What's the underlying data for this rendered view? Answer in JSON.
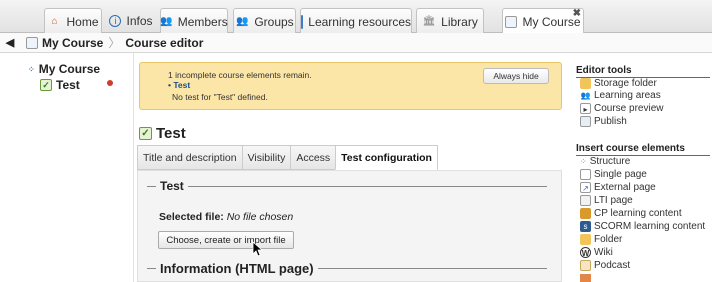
{
  "tabs": [
    {
      "label": "Home",
      "icon": "home-icon"
    },
    {
      "label": "Infos",
      "icon": "info-icon"
    },
    {
      "label": "Members",
      "icon": "members-icon"
    },
    {
      "label": "Groups",
      "icon": "groups-icon"
    },
    {
      "label": "Learning resources",
      "icon": "learning-resources-icon"
    },
    {
      "label": "Library",
      "icon": "library-icon"
    },
    {
      "label": "My Course",
      "icon": "course-icon",
      "active": true
    }
  ],
  "breadcrumb": {
    "course": "My Course",
    "current": "Course editor"
  },
  "tree": {
    "root": "My Course",
    "child": "Test"
  },
  "warning": {
    "line1": "1 incomplete course elements remain.",
    "item": "Test",
    "detail": "No test for \"Test\" defined.",
    "hide_button": "Always hide"
  },
  "element": {
    "title": "Test",
    "tabs": [
      "Title and description",
      "Visibility",
      "Access",
      "Test configuration"
    ],
    "active_tab": "Test configuration"
  },
  "test_section": {
    "legend": "Test",
    "selected_label": "Selected file:",
    "selected_value": "No file chosen",
    "choose_button": "Choose, create or import file"
  },
  "info_section": {
    "legend": "Information (HTML page)"
  },
  "editor_tools": {
    "heading": "Editor tools",
    "items": [
      "Storage folder",
      "Learning areas",
      "Course preview",
      "Publish"
    ]
  },
  "insert_elements": {
    "heading": "Insert course elements",
    "items": [
      "Structure",
      "Single page",
      "External page",
      "LTI page",
      "CP learning content",
      "SCORM learning content",
      "Folder",
      "Wiki",
      "Podcast"
    ]
  },
  "colors": {
    "warning_bg": "#fbe6a8",
    "link_blue": "#1a4f8a"
  }
}
